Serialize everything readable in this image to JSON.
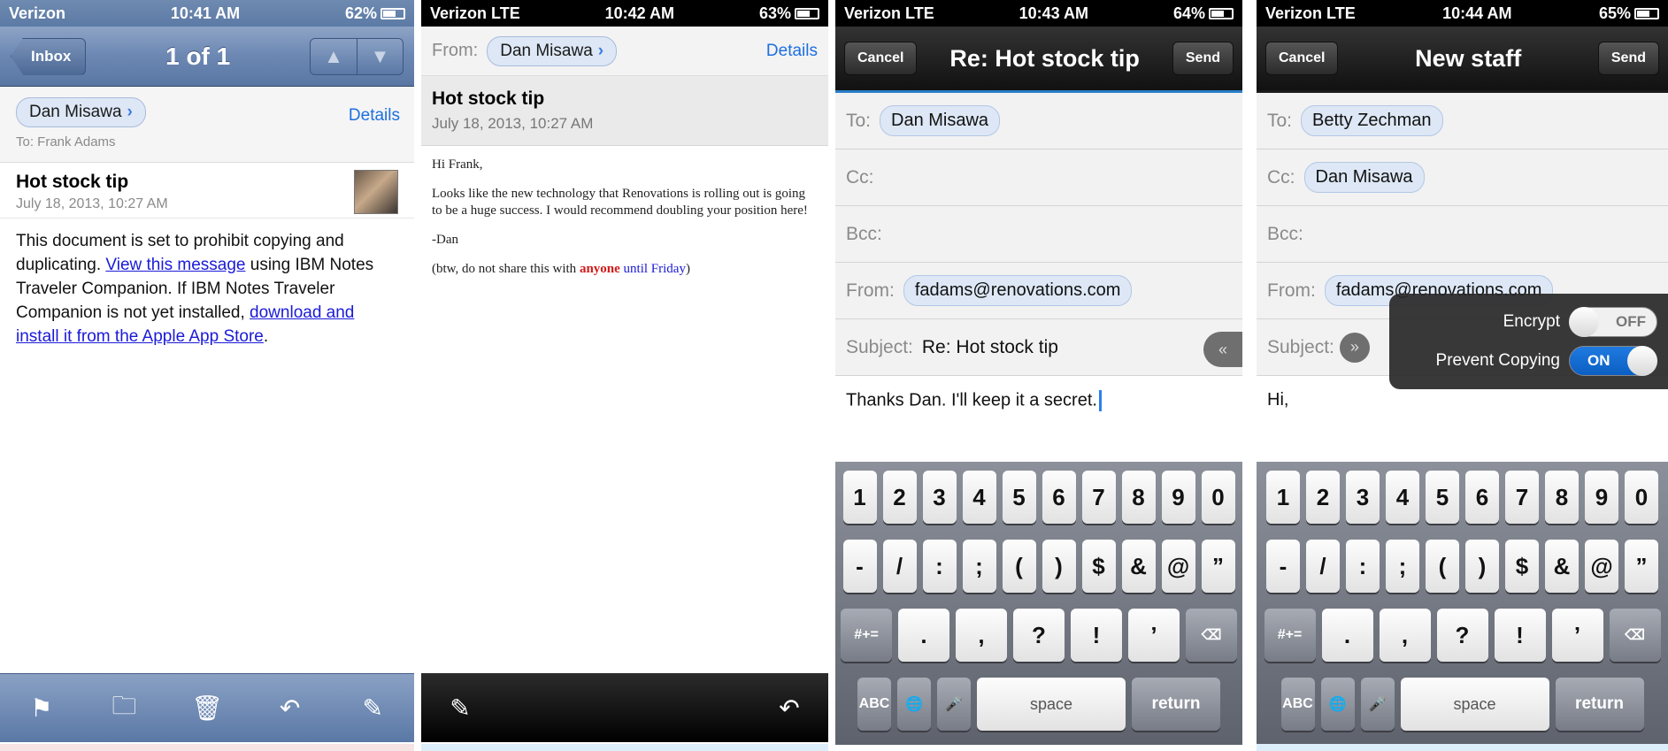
{
  "screen1": {
    "status": {
      "carrier": "Verizon",
      "time": "10:41 AM",
      "battery": "62%"
    },
    "nav": {
      "back_label": "Inbox",
      "title": "1 of 1",
      "up": "▲",
      "down": "▼"
    },
    "sender": "Dan Misawa",
    "details_label": "Details",
    "to_line": "To: Frank Adams",
    "subject": "Hot stock tip",
    "date": "July 18, 2013, 10:27 AM",
    "body": {
      "p1": "This document is set to prohibit copying and duplicating.",
      "link1": "View this message",
      "p2": "using IBM Notes Traveler Companion. If IBM Notes Traveler Companion is not yet installed,",
      "link2": "download and install it from the Apple App Store",
      "end": "."
    },
    "toolbar_icons": [
      "flag-icon",
      "folder-icon",
      "trash-icon",
      "reply-icon",
      "compose-icon"
    ],
    "accent": "#5a78a6"
  },
  "screen2": {
    "status": {
      "carrier": "Verizon",
      "network": "LTE",
      "time": "10:42 AM",
      "battery": "63%"
    },
    "from_label": "From:",
    "sender": "Dan Misawa",
    "details_label": "Details",
    "subject": "Hot stock tip",
    "date": "July 18, 2013, 10:27 AM",
    "body": {
      "greeting": "Hi Frank,",
      "p1": "Looks like the new technology that Renovations is rolling out is going to be a huge success. I would recommend doubling your position here!",
      "sign": "-Dan",
      "p3a": "(btw, do not share this with",
      "p3_red": "anyone",
      "p3_blue": "until Friday",
      "p3b": ")"
    },
    "toolbar_icons": [
      "compose-icon",
      "reply-icon"
    ]
  },
  "screen3": {
    "status": {
      "carrier": "Verizon",
      "network": "LTE",
      "time": "10:43 AM",
      "battery": "64%"
    },
    "cancel": "Cancel",
    "title": "Re: Hot stock tip",
    "send": "Send",
    "to_label": "To:",
    "to_value": "Dan Misawa",
    "cc_label": "Cc:",
    "bcc_label": "Bcc:",
    "from_label": "From:",
    "from_value": "fadams@renovations.com",
    "subject_label": "Subject:",
    "subject_value": "Re: Hot stock tip",
    "collapse": "«",
    "body": "Thanks Dan.  I'll keep it a secret."
  },
  "screen4": {
    "status": {
      "carrier": "Verizon",
      "network": "LTE",
      "time": "10:44 AM",
      "battery": "65%"
    },
    "cancel": "Cancel",
    "title": "New staff",
    "send": "Send",
    "to_label": "To:",
    "to_value": "Betty Zechman",
    "cc_label": "Cc:",
    "cc_value": "Dan Misawa",
    "bcc_label": "Bcc:",
    "from_label": "From:",
    "from_value": "fadams@renovations.com",
    "subject_label": "Subject:",
    "expand": "»",
    "popover": {
      "encrypt_label": "Encrypt",
      "encrypt_state": "OFF",
      "copy_label": "Prevent Copying",
      "copy_state": "ON"
    },
    "body": "Hi,"
  },
  "keyboard": {
    "row1": [
      "1",
      "2",
      "3",
      "4",
      "5",
      "6",
      "7",
      "8",
      "9",
      "0"
    ],
    "row2": [
      "-",
      "/",
      ":",
      ";",
      "(",
      ")",
      "$",
      "&",
      "@",
      "”"
    ],
    "row3_mode": "#+=",
    "row3": [
      ".",
      ",",
      "?",
      "!",
      "’"
    ],
    "backspace": "⌫",
    "abc": "ABC",
    "globe": "🌐",
    "mic": "🎤",
    "space": "space",
    "return": "return"
  }
}
